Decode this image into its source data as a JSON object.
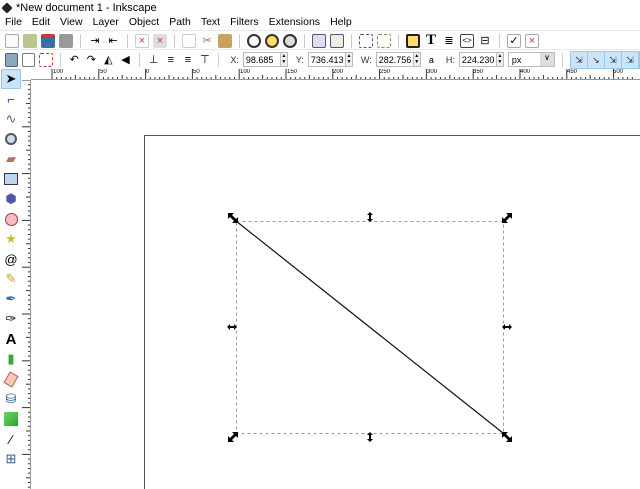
{
  "window": {
    "title": "*New document 1 - Inkscape"
  },
  "menu": [
    "File",
    "Edit",
    "View",
    "Layer",
    "Object",
    "Path",
    "Text",
    "Filters",
    "Extensions",
    "Help"
  ],
  "toolbar_icons": [
    "new-icon",
    "open-icon",
    "save-icon",
    "print-icon",
    "import-icon",
    "export-icon",
    "undo-icon",
    "redo-icon",
    "copy-icon",
    "cut-icon",
    "paste-icon",
    "zoom-selection-icon",
    "zoom-drawing-icon",
    "zoom-page-icon",
    "duplicate-icon",
    "clone-icon",
    "group-icon",
    "ungroup-icon",
    "fill-stroke-icon",
    "text-font-icon",
    "layers-icon",
    "xml-editor-icon",
    "align-icon",
    "preferences-icon",
    "document-properties-icon"
  ],
  "select_toolbar": {
    "x_label": "X:",
    "x": "98.685",
    "y_label": "Y:",
    "y": "736.413",
    "w_label": "W:",
    "w": "282.756",
    "h_label": "H:",
    "h": "224.230",
    "unit": "px"
  },
  "ruler": {
    "h_labels": [
      "100",
      "50",
      "0",
      "50",
      "100",
      "150",
      "200",
      "250",
      "300",
      "350",
      "400",
      "450",
      "500"
    ]
  },
  "tools": [
    "selector-tool",
    "node-tool",
    "tweak-tool",
    "zoom-tool",
    "measure-tool",
    "rectangle-tool",
    "3dbox-tool",
    "ellipse-tool",
    "star-tool",
    "spiral-tool",
    "pencil-tool",
    "pen-tool",
    "calligraphy-tool",
    "text-tool",
    "spray-tool",
    "eraser-tool",
    "paint-bucket-tool",
    "gradient-tool",
    "dropper-tool",
    "connector-tool"
  ],
  "colors": {
    "accent": "#cce4f7"
  }
}
